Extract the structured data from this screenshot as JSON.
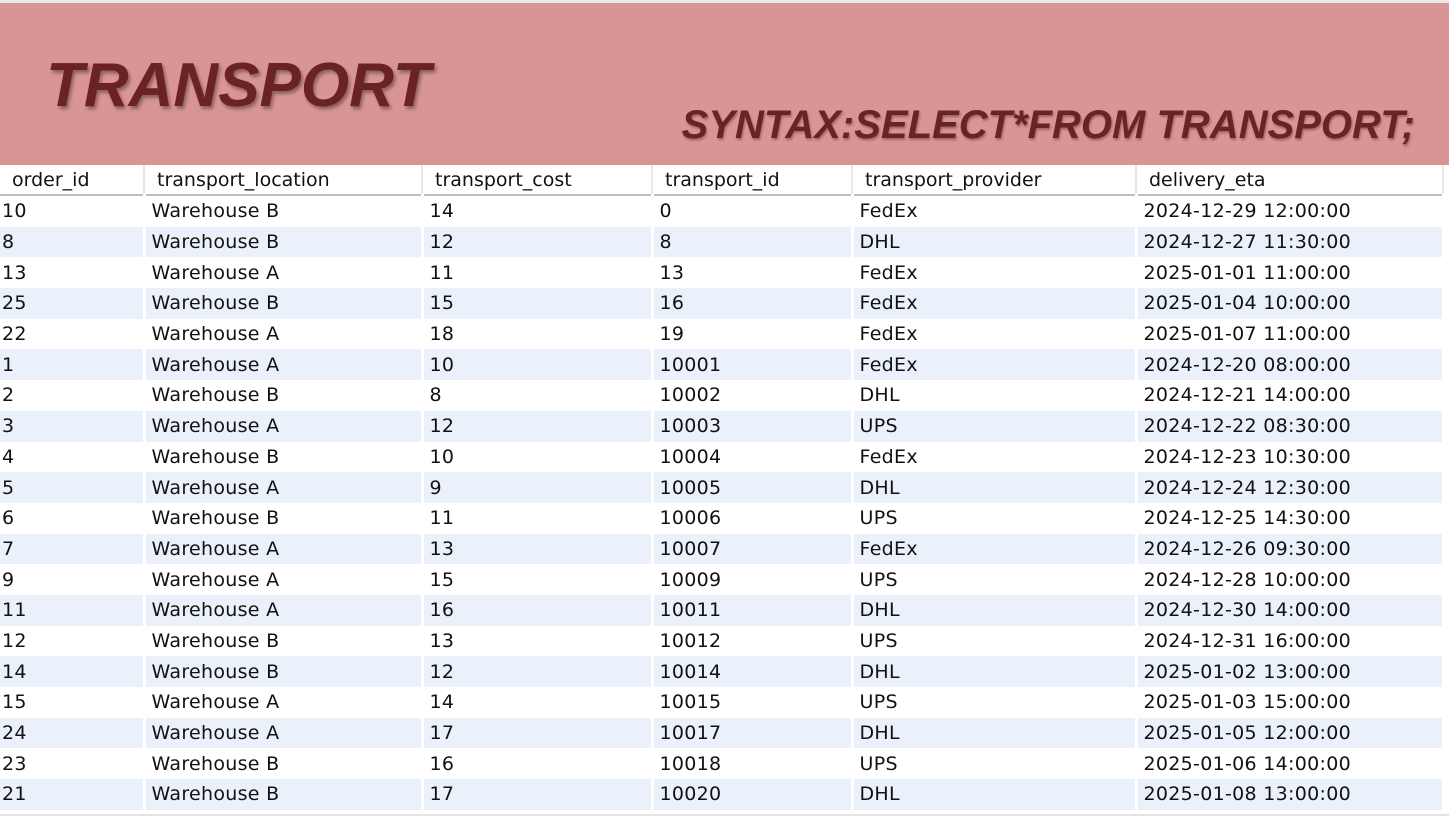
{
  "header": {
    "title": "TRANSPORT",
    "syntax": "SYNTAX:SELECT*FROM TRANSPORT;"
  },
  "table": {
    "columns": [
      "order_id",
      "transport_location",
      "transport_cost",
      "transport_id",
      "transport_provider",
      "delivery_eta"
    ],
    "rows": [
      [
        "10",
        "Warehouse B",
        "14",
        "0",
        "FedEx",
        "2024-12-29 12:00:00"
      ],
      [
        "8",
        "Warehouse B",
        "12",
        "8",
        "DHL",
        "2024-12-27 11:30:00"
      ],
      [
        "13",
        "Warehouse A",
        "11",
        "13",
        "FedEx",
        "2025-01-01 11:00:00"
      ],
      [
        "25",
        "Warehouse B",
        "15",
        "16",
        "FedEx",
        "2025-01-04 10:00:00"
      ],
      [
        "22",
        "Warehouse A",
        "18",
        "19",
        "FedEx",
        "2025-01-07 11:00:00"
      ],
      [
        "1",
        "Warehouse A",
        "10",
        "10001",
        "FedEx",
        "2024-12-20 08:00:00"
      ],
      [
        "2",
        "Warehouse B",
        "8",
        "10002",
        "DHL",
        "2024-12-21 14:00:00"
      ],
      [
        "3",
        "Warehouse A",
        "12",
        "10003",
        "UPS",
        "2024-12-22 08:30:00"
      ],
      [
        "4",
        "Warehouse B",
        "10",
        "10004",
        "FedEx",
        "2024-12-23 10:30:00"
      ],
      [
        "5",
        "Warehouse A",
        "9",
        "10005",
        "DHL",
        "2024-12-24 12:30:00"
      ],
      [
        "6",
        "Warehouse B",
        "11",
        "10006",
        "UPS",
        "2024-12-25 14:30:00"
      ],
      [
        "7",
        "Warehouse A",
        "13",
        "10007",
        "FedEx",
        "2024-12-26 09:30:00"
      ],
      [
        "9",
        "Warehouse A",
        "15",
        "10009",
        "UPS",
        "2024-12-28 10:00:00"
      ],
      [
        "11",
        "Warehouse A",
        "16",
        "10011",
        "DHL",
        "2024-12-30 14:00:00"
      ],
      [
        "12",
        "Warehouse B",
        "13",
        "10012",
        "UPS",
        "2024-12-31 16:00:00"
      ],
      [
        "14",
        "Warehouse B",
        "12",
        "10014",
        "DHL",
        "2025-01-02 13:00:00"
      ],
      [
        "15",
        "Warehouse A",
        "14",
        "10015",
        "UPS",
        "2025-01-03 15:00:00"
      ],
      [
        "24",
        "Warehouse A",
        "17",
        "10017",
        "DHL",
        "2025-01-05 12:00:00"
      ],
      [
        "23",
        "Warehouse B",
        "16",
        "10018",
        "UPS",
        "2025-01-06 14:00:00"
      ],
      [
        "21",
        "Warehouse B",
        "17",
        "10020",
        "DHL",
        "2025-01-08 13:00:00"
      ]
    ]
  },
  "colors": {
    "header_bg": "#d89594",
    "title_text": "#6b2222",
    "row_alt_bg": "#eaf1fb",
    "row_bg": "#ffffff"
  }
}
